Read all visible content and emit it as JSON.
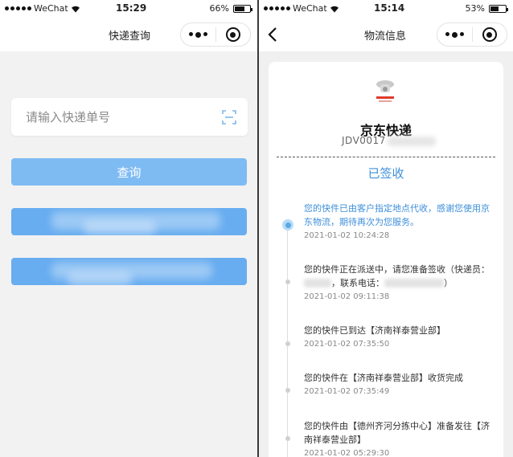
{
  "left": {
    "status": {
      "carrier": "WeChat",
      "time": "15:29",
      "battery": "66%",
      "battery_level": 66
    },
    "nav": {
      "title": "快递查询"
    },
    "search": {
      "placeholder": "请输入快递单号",
      "icon": "scan-icon"
    },
    "buttons": {
      "query_label": "查询"
    }
  },
  "right": {
    "status": {
      "carrier": "WeChat",
      "time": "15:14",
      "battery": "53%",
      "battery_level": 53
    },
    "nav": {
      "title": "物流信息"
    },
    "card": {
      "company": "京东快递",
      "waybill_prefix": "JDV0017",
      "status": "已签收",
      "events": [
        {
          "desc": "您的快件已由客户指定地点代收，感谢您使用京东物流，期待再次为您服务。",
          "time": "2021-01-02 10:24:28"
        },
        {
          "desc_a": "您的快件正在派送中，请您准备签收（快递员：",
          "desc_b": "，联系电话：",
          "desc_c": "）",
          "time": "2021-01-02 09:11:38"
        },
        {
          "desc": "您的快件已到达【济南祥泰营业部】",
          "time": "2021-01-02 07:35:50"
        },
        {
          "desc": "您的快件在【济南祥泰营业部】收货完成",
          "time": "2021-01-02 07:35:49"
        },
        {
          "desc": "您的快件由【德州齐河分拣中心】准备发往【济南祥泰营业部】",
          "time": "2021-01-02 05:29:30"
        }
      ]
    }
  },
  "colors": {
    "primary_button": "#7fbbf3",
    "accent_blue": "#3d8fd9",
    "timeline_active": "#5aa9e6"
  }
}
